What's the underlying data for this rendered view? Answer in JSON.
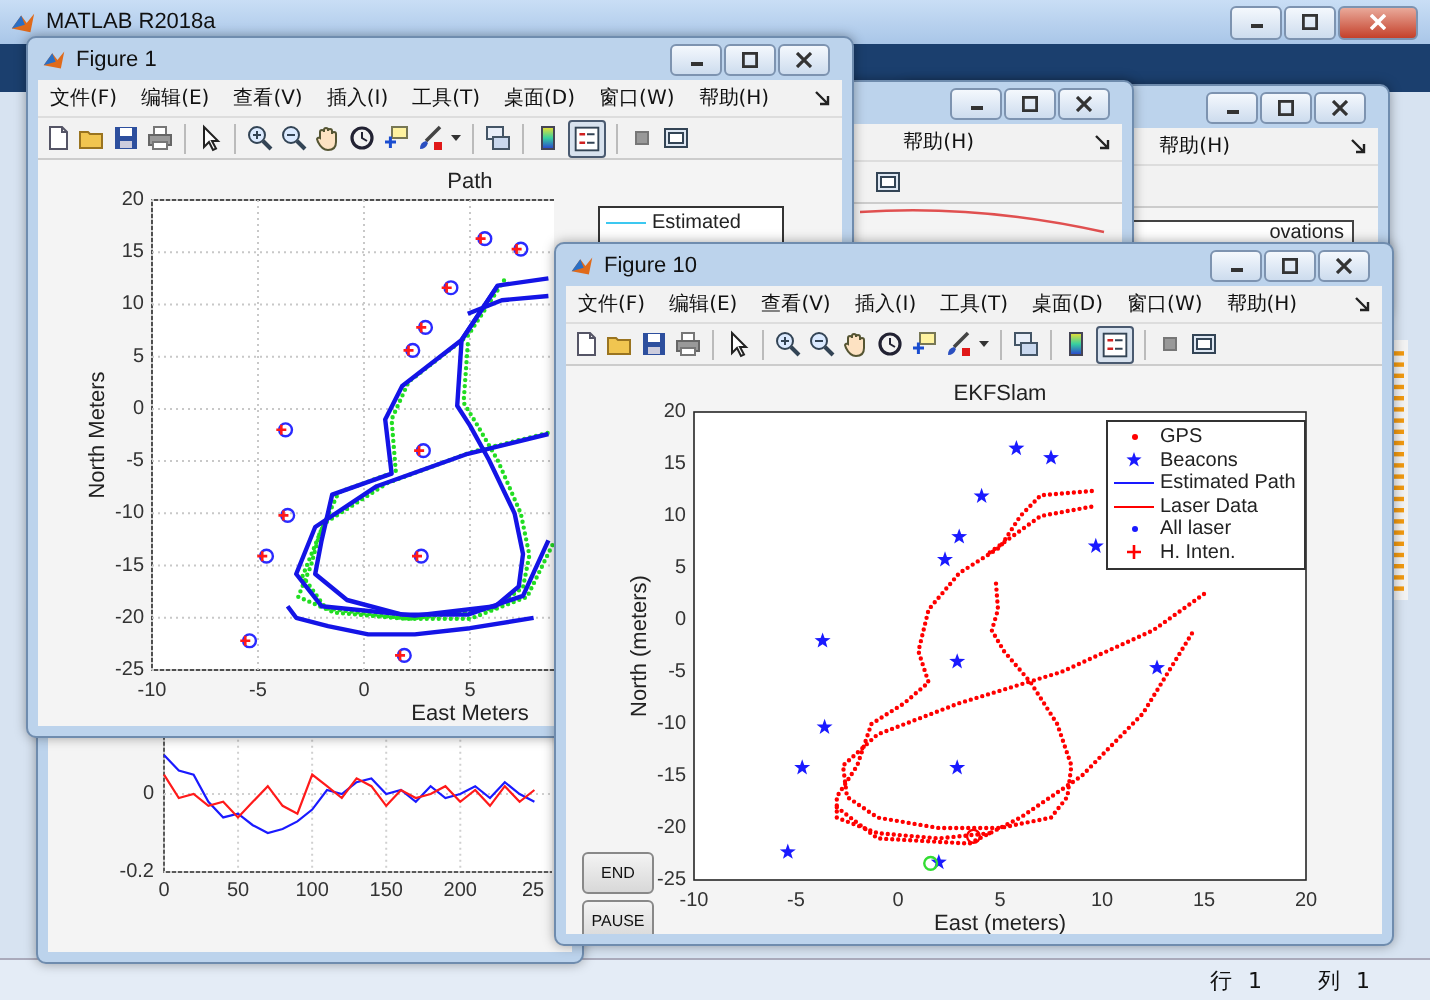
{
  "window": {
    "title": "MATLAB R2018a"
  },
  "back_figures": [
    {
      "menu_item": "帮助(H)"
    },
    {
      "menu_item": "帮助(H)",
      "legend_item": "ovations"
    }
  ],
  "noise_plot": {
    "chart_data": {
      "type": "line",
      "x": [
        0,
        10,
        20,
        30,
        40,
        50,
        60,
        70,
        80,
        90,
        100,
        110,
        120,
        130,
        140,
        150,
        160,
        170,
        180,
        190,
        200,
        210,
        220,
        230,
        240,
        250
      ],
      "xlim": [
        0,
        270
      ],
      "ylim": [
        -0.2,
        0.17
      ],
      "grid": true,
      "xticks": [
        0,
        50,
        100,
        150,
        200
      ],
      "yticks": [
        0,
        -0.2
      ],
      "series": [
        {
          "color": "#1a1aff",
          "values": [
            0.1,
            0.06,
            0.05,
            -0.02,
            -0.06,
            -0.05,
            -0.08,
            -0.1,
            -0.09,
            -0.07,
            -0.04,
            0.01,
            0.0,
            0.03,
            0.04,
            0.0,
            0.01,
            -0.02,
            0.02,
            -0.01,
            0.0,
            0.02,
            -0.01,
            0.03,
            0.0,
            -0.02
          ]
        },
        {
          "color": "#ff1a1a",
          "values": [
            0.05,
            -0.01,
            0.0,
            -0.03,
            -0.02,
            -0.06,
            -0.02,
            0.02,
            -0.03,
            -0.05,
            0.05,
            0.02,
            -0.01,
            0.04,
            0.02,
            -0.03,
            0.01,
            -0.01,
            0.0,
            0.02,
            -0.02,
            0.01,
            -0.03,
            0.02,
            -0.02,
            0.01
          ]
        }
      ]
    },
    "cut_tick_label": "25"
  },
  "figures": [
    {
      "title": "Figure 1",
      "menu": [
        "文件(F)",
        "编辑(E)",
        "查看(V)",
        "插入(I)",
        "工具(T)",
        "桌面(D)",
        "窗口(W)",
        "帮助(H)"
      ],
      "legend_toggle_on": true,
      "legend": [
        {
          "label": "Estimated",
          "color": "#3cc8f0"
        }
      ],
      "chart_data": {
        "type": "line",
        "title": "Path",
        "xlabel": "East Meters",
        "ylabel": "North Meters",
        "xlim": [
          -10,
          20
        ],
        "ylim": [
          -25,
          20
        ],
        "xticks": [
          -10,
          -5,
          0,
          5
        ],
        "yticks": [
          20,
          15,
          10,
          5,
          0,
          -5,
          -10,
          -15,
          -20,
          -25
        ],
        "grid": true,
        "series": [
          {
            "line_style": "dotted",
            "color": "#22dd22",
            "x": [
              6.6,
              4.9,
              2.1,
              1.3,
              1.5,
              -1.2,
              -2.1,
              -2.5,
              -3.1,
              -1.4,
              2,
              5,
              7.7,
              8.9
            ],
            "values": [
              12.3,
              7,
              2.6,
              -1,
              -6,
              -8,
              -12,
              -15,
              -18,
              -19.5,
              -20.1,
              -20.1,
              -18,
              -13
            ]
          },
          {
            "line_style": "dotted",
            "color": "#22dd22",
            "x": [
              4.9,
              4.7,
              5.3,
              6.3,
              7.4,
              7.8,
              7.5,
              6.1,
              2.1,
              -1.8,
              -2.9,
              -1.9,
              1.1,
              5.1,
              8.9
            ],
            "values": [
              6.2,
              0.6,
              -1.4,
              -4.9,
              -10,
              -14,
              -17.1,
              -19.1,
              -20.1,
              -19.1,
              -16,
              -11,
              -7.1,
              -4.1,
              -2.2
            ]
          },
          {
            "line_style": "solid",
            "color": "#1414e6",
            "x": [
              6.3,
              4.6,
              1.8,
              1,
              1.3,
              -1.5,
              -2,
              -2.3,
              -0.8,
              1.8,
              4.9,
              7.5,
              8.7
            ],
            "values": [
              11.8,
              6.6,
              2.2,
              -1,
              -6.2,
              -8.2,
              -12.6,
              -15.8,
              -18.3,
              -19.7,
              -19.7,
              -17.9,
              -12.6
            ]
          },
          {
            "line_style": "solid",
            "color": "#1414e6",
            "x": [
              8.7,
              6.3,
              4.6,
              4.4,
              5,
              5.9,
              7.1,
              7.5,
              7.3,
              6.2,
              2.4,
              -2,
              -3.2,
              -2.3,
              0.6,
              4.9,
              8.7
            ],
            "values": [
              12.5,
              11.8,
              6.6,
              0.3,
              -1.6,
              -4.9,
              -10,
              -13.9,
              -17,
              -18.9,
              -19.8,
              -18.9,
              -15.8,
              -11.3,
              -7.4,
              -4.3,
              -2.4
            ]
          },
          {
            "line_style": "solid",
            "color": "#1414e6",
            "x": [
              8.7,
              6.5,
              4.9
            ],
            "values": [
              10.8,
              10.4,
              9.1
            ]
          },
          {
            "line_style": "solid",
            "color": "#1414e6",
            "x": [
              -3.6,
              -3.2,
              -1.7,
              0.2,
              2.4,
              5,
              8
            ],
            "values": [
              -18.9,
              -20,
              -20.8,
              -21.6,
              -21.6,
              -21,
              -20
            ]
          },
          {
            "type": "scatter",
            "marker": "circle",
            "color": "#2a2aff",
            "x": [
              5.7,
              7.4,
              4.1,
              2.9,
              2.3,
              -3.7,
              2.8,
              -3.6,
              -4.6,
              2.7,
              -5.4,
              1.9
            ],
            "values": [
              16.3,
              15.3,
              11.6,
              7.8,
              5.6,
              -2,
              -4,
              -10.2,
              -14.1,
              -14.1,
              -22.2,
              -23.6
            ]
          },
          {
            "type": "scatter",
            "marker": "cross",
            "color": "#ff1a1a",
            "x": [
              5.5,
              7.2,
              3.9,
              2.7,
              2.1,
              -3.9,
              2.6,
              -3.8,
              -4.8,
              2.5,
              -5.6,
              1.7
            ],
            "values": [
              16.3,
              15.3,
              11.6,
              7.8,
              5.6,
              -2,
              -4,
              -10.2,
              -14.1,
              -14.1,
              -22.2,
              -23.6
            ]
          }
        ]
      }
    },
    {
      "title": "Figure 10",
      "menu": [
        "文件(F)",
        "编辑(E)",
        "查看(V)",
        "插入(I)",
        "工具(T)",
        "桌面(D)",
        "窗口(W)",
        "帮助(H)"
      ],
      "legend_toggle_on": true,
      "legend": [
        {
          "label": "GPS",
          "color": "#ff0000",
          "kind": "dot"
        },
        {
          "label": "Beacons",
          "color": "#1a1aff",
          "kind": "star"
        },
        {
          "label": "Estimated Path",
          "color": "#1a1aff",
          "kind": "line"
        },
        {
          "label": "Laser Data",
          "color": "#ff0000",
          "kind": "line"
        },
        {
          "label": "All laser",
          "color": "#1a1aff",
          "kind": "dot"
        },
        {
          "label": "H. Inten.",
          "color": "#ff0000",
          "kind": "plus"
        }
      ],
      "chart_data": {
        "type": "line",
        "title": "EKFSlam",
        "xlabel": "East (meters)",
        "ylabel": "North (meters)",
        "xlim": [
          -10,
          20
        ],
        "ylim": [
          -25,
          20
        ],
        "xticks": [
          -10,
          -5,
          0,
          5,
          10,
          15,
          20
        ],
        "yticks": [
          20,
          15,
          10,
          5,
          0,
          -5,
          -10,
          -15,
          -20,
          -25
        ],
        "grid": false,
        "series": [
          {
            "line_style": "dotted",
            "color": "#ff0000",
            "x": [
              9.5,
              7,
              6,
              5,
              3,
              1.5,
              1,
              1.5,
              0.3,
              -1.3,
              -2,
              -3,
              -3,
              -1,
              2,
              4.5
            ],
            "values": [
              12.4,
              12,
              10,
              7,
              4.5,
              1,
              -3,
              -6,
              -8,
              -10,
              -14,
              -17,
              -19,
              -20.5,
              -21,
              -20.5
            ]
          },
          {
            "line_style": "dotted",
            "color": "#ff0000",
            "x": [
              4.8,
              4.9,
              4.6,
              5.2,
              6.5,
              7.8,
              8.5,
              8.3,
              7.5,
              5,
              2,
              -1,
              -2.5,
              -2.7,
              -1,
              3,
              8,
              12.5,
              15
            ],
            "values": [
              3.5,
              1,
              -1,
              -3,
              -6,
              -10,
              -14,
              -17,
              -19,
              -20,
              -20,
              -19,
              -17,
              -14,
              -11,
              -8,
              -5,
              -1,
              2.5
            ]
          },
          {
            "line_style": "dotted",
            "color": "#ff0000",
            "x": [
              4.5,
              7,
              9.5
            ],
            "values": [
              6.5,
              10,
              10.9
            ]
          },
          {
            "line_style": "dotted",
            "color": "#ff0000",
            "x": [
              -3,
              -1,
              3.5,
              6,
              9,
              12,
              14.5
            ],
            "values": [
              -18,
              -21,
              -21.5,
              -19,
              -15,
              -9,
              -1
            ]
          },
          {
            "type": "scatter",
            "marker": "star",
            "color": "#1a1aff",
            "x": [
              5.8,
              7.5,
              4.1,
              3,
              2.3,
              9.7,
              -3.7,
              2.9,
              12.7,
              -3.6,
              -4.7,
              2.9,
              -5.4,
              2
            ],
            "values": [
              16.5,
              15.6,
              11.9,
              8,
              5.8,
              7.1,
              -2,
              -4,
              -4.6,
              -10.3,
              -14.2,
              -14.2,
              -22.3,
              -23.3
            ]
          },
          {
            "type": "scatter",
            "marker": "circle",
            "color": "#33dd33",
            "x": [
              1.6
            ],
            "values": [
              -23.4
            ]
          },
          {
            "type": "scatter",
            "marker": "circle",
            "color": "#ff0000",
            "x": [
              3.7
            ],
            "values": [
              -20.8
            ]
          }
        ]
      },
      "buttons": [
        "END",
        "PAUSE"
      ]
    }
  ],
  "status_bar": {
    "row_label": "行",
    "row": "1",
    "col_label": "列",
    "col": "1"
  }
}
